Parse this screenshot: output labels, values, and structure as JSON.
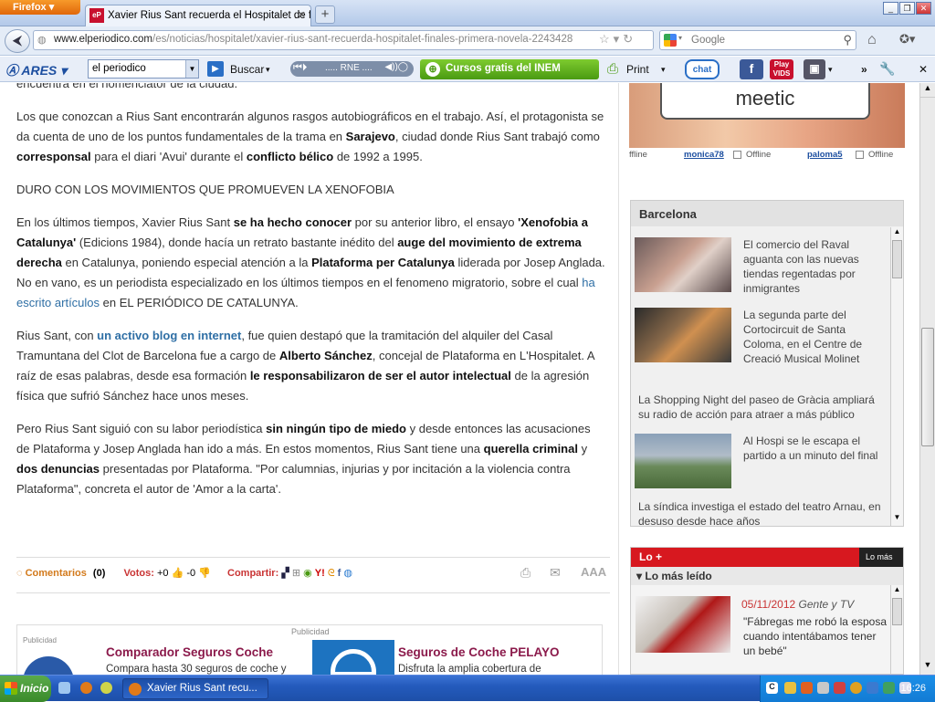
{
  "browser": {
    "menu_button": "Firefox",
    "tab_title": "Xavier Rius Sant recuerda el Hospitalet de fi...",
    "tab_favicon": "eP",
    "url_domain": "www.elperiodico.com",
    "url_path": "/es/noticias/hospitalet/xavier-rius-sant-recuerda-hospitalet-finales-primera-novela-2243428",
    "search_engine": "Google",
    "search_placeholder": "Google"
  },
  "toolbar": {
    "brand": "ARES",
    "search_context": "el periodico",
    "search_button": "Buscar",
    "radio_station": "..... RNE ....",
    "inem_link": "Cursos gratis del INEM",
    "print_label": "Print",
    "chat_label": "chat",
    "play_label": "Play",
    "vids_label": "VIDS",
    "more_label": "»"
  },
  "article": {
    "p0": "encuentra en el nomenclátor de la ciudad.",
    "p1_a": "Los que conozcan a Rius Sant encontrarán algunos rasgos autobiográficos en el trabajo. Así, el protagonista se da cuenta de uno de los puntos fundamentales de la trama en ",
    "p1_b": "Sarajevo",
    "p1_c": ", ciudad donde Rius Sant trabajó como ",
    "p1_d": "corresponsal",
    "p1_e": " para el diari 'Avui' durante el ",
    "p1_f": "conflicto bélico",
    "p1_g": " de 1992 a 1995.",
    "heading": "DURO CON LOS MOVIMIENTOS QUE PROMUEVEN LA XENOFOBIA",
    "p2_a": "En los últimos tiempos, Xavier Rius Sant ",
    "p2_b": "se ha hecho conocer",
    "p2_c": " por su anterior libro, el ensayo ",
    "p2_d": "'Xenofobia a Catalunya'",
    "p2_e": " (Edicions 1984), donde hacía un retrato bastante inédito del ",
    "p2_f": "auge del movimiento de extrema derecha",
    "p2_g": " en Catalunya, poniendo especial atención a la ",
    "p2_h": "Plataforma per Catalunya",
    "p2_i": " liderada por Josep Anglada. No en vano, es un periodista especializado en los últimos tiempos en el fenomeno migratorio, sobre el cual ",
    "p2_link": "ha escrito artículos",
    "p2_j": " en EL PERIÓDICO DE CATALUNYA.",
    "p3_a": "Rius Sant, con ",
    "p3_link": "un activo blog en internet",
    "p3_b": ", fue quien destapó que la tramitación del alquiler del Casal Tramuntana del Clot de Barcelona fue a cargo de ",
    "p3_c": "Alberto Sánchez",
    "p3_d": ", concejal de Plataforma en L'Hospitalet. A raíz de esas palabras, desde esa formación ",
    "p3_e": "le responsabilizaron de ser el autor intelectual",
    "p3_f": " de la agresión física que sufrió Sánchez hace unos meses.",
    "p4_a": "Pero Rius Sant siguió con su labor periodística ",
    "p4_b": "sin ningún tipo de miedo",
    "p4_c": " y desde entonces las acusaciones de Plataforma y Josep Anglada han ido a más. En estos momentos, Rius Sant tiene una ",
    "p4_d": "querella criminal",
    "p4_e": " y ",
    "p4_f": "dos denuncias",
    "p4_g": " presentadas por Plataforma. \"Por calumnias, injurias y por incitación a la violencia contra Plataforma\", concreta el autor de 'Amor a la carta'."
  },
  "actions": {
    "comments_label": "Comentarios",
    "comments_count": "(0)",
    "votes_label": "Votos:",
    "votes_up": "+0",
    "votes_down": "-0",
    "share_label": "Compartir:",
    "font_size": "AAA"
  },
  "ad": {
    "publicidad": "Publicidad",
    "publicidad_small": "Publicidad",
    "left_title": "Comparador Seguros Coche",
    "left_text": "Compara hasta 30 seguros de coche y",
    "right_title": "Seguros de Coche PELAYO",
    "right_text": "Disfruta la amplia cobertura de"
  },
  "meetic": {
    "logo": "meetic",
    "status_1": "ffline",
    "user_1": "monica78",
    "status_2": "Offline",
    "user_2": "paloma5",
    "status_3": "Offline"
  },
  "barcelona": {
    "title": "Barcelona",
    "items": [
      "El comercio del Raval aguanta con las nuevas tiendas regentadas por inmigrantes",
      "La segunda parte del Cortocircuit de Santa Coloma, en el Centre de Creació Musical Molinet",
      "La Shopping Night del paseo de Gràcia ampliará su radio de acción para atraer a más público",
      "Al Hospi se le escapa el partido a un minuto del final",
      "La síndica investiga el estado del teatro Arnau, en desuso desde hace años"
    ]
  },
  "lomas": {
    "title": "Lo +",
    "tab": "Lo más",
    "subtitle": "Lo más leído",
    "date": "05/11/2012",
    "section": "Gente y TV",
    "headline": "\"Fábregas me robó la esposa cuando intentábamos tener un bebé\""
  },
  "taskbar": {
    "start": "Inicio",
    "app": "Xavier Rius Sant recu...",
    "clock": "16:26"
  },
  "colors": {
    "link": "#2f6fa5",
    "accent_red": "#d7181f",
    "ad_title": "#8b1a4b"
  }
}
